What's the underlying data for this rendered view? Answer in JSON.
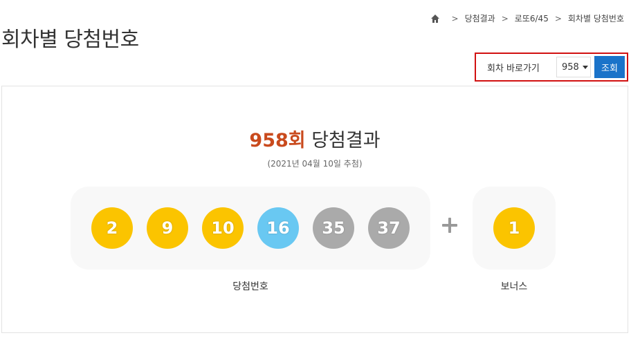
{
  "page": {
    "title": "회차별 당첨번호"
  },
  "breadcrumb": {
    "items": [
      "당첨결과",
      "로또6/45",
      "회차별 당첨번호"
    ]
  },
  "round_jump": {
    "label": "회차 바로가기",
    "selected_round": "958",
    "button_label": "조회"
  },
  "result": {
    "round_label": "958회",
    "heading_suffix": " 당첨결과",
    "draw_date": "(2021년 04월 10일 추첨)",
    "winning_numbers": [
      {
        "number": "2",
        "color": "#fbc400"
      },
      {
        "number": "9",
        "color": "#fbc400"
      },
      {
        "number": "10",
        "color": "#fbc400"
      },
      {
        "number": "16",
        "color": "#69c8f2"
      },
      {
        "number": "35",
        "color": "#aaaaaa"
      },
      {
        "number": "37",
        "color": "#aaaaaa"
      }
    ],
    "bonus_number": {
      "number": "1",
      "color": "#fbc400"
    },
    "winning_label": "당첨번호",
    "bonus_label": "보너스"
  },
  "colors": {
    "accent_blue": "#1a73c9",
    "round_red": "#c94a1d",
    "highlight_border": "#d11010"
  }
}
